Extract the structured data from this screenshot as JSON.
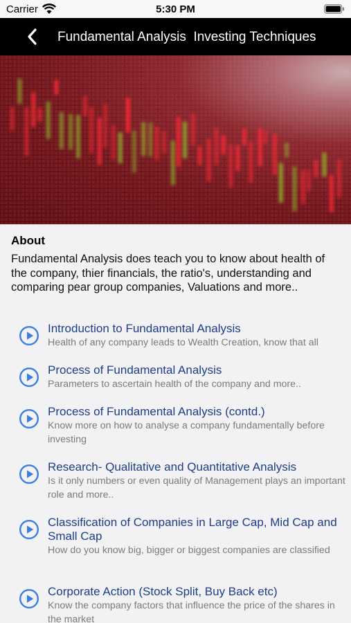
{
  "status_bar": {
    "carrier": "Carrier",
    "time": "5:30 PM"
  },
  "nav": {
    "title": "Fundamental Analysis  Investing Techniques"
  },
  "about": {
    "heading": "About",
    "text": "Fundamental Analysis does teach you to know about health of the company, thier financials, the ratio's, understanding and comparing pear group companies, Valuations and more.."
  },
  "lessons": [
    {
      "title": "Introduction to Fundamental Analysis",
      "desc": "Health of any company leads to Wealth Creation, know that all"
    },
    {
      "title": "Process of Fundamental Analysis",
      "desc": "Parameters to ascertain health of the company and more.."
    },
    {
      "title": "Process of Fundamental Analysis (contd.)",
      "desc": "Know more on how to analyse a company fundamentally before investing"
    },
    {
      "title": "Research- Qualitative and Quantitative Analysis",
      "desc": "Is it only numbers or even quality of Management plays an important role and more.."
    },
    {
      "title": "Classification of Companies in Large Cap, Mid Cap and Small Cap",
      "desc": "How do you know big, bigger or biggest companies are classified"
    },
    {
      "title": "Corporate Action (Stock Split, Buy Back etc)",
      "desc": "Know the company factors that influence the price of the shares in the market"
    }
  ],
  "colors": {
    "nav_bg": "#000000",
    "link_blue": "#1d3e86",
    "play_icon": "#3b7ee0"
  }
}
